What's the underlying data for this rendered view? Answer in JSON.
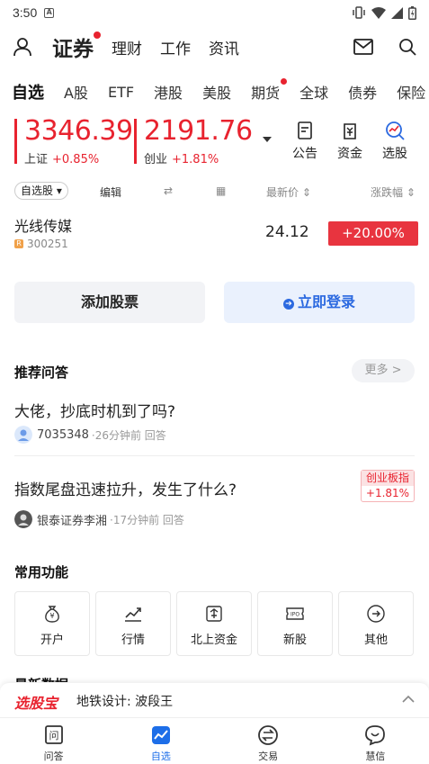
{
  "status_bar": {
    "time": "3:50",
    "notif_letter": "A"
  },
  "top_nav": {
    "items": [
      "证券",
      "理财",
      "工作",
      "资讯"
    ]
  },
  "tabs": [
    "自选",
    "A股",
    "ETF",
    "港股",
    "美股",
    "期货",
    "全球",
    "债券",
    "保险"
  ],
  "indices": [
    {
      "value": "3346.39",
      "name": "上证",
      "change": "+0.85%"
    },
    {
      "value": "2191.76",
      "name": "创业",
      "change": "+1.81%"
    }
  ],
  "quick_actions": [
    "公告",
    "资金",
    "选股"
  ],
  "list_header": {
    "group": "自选股",
    "edit": "编辑",
    "latest": "最新价 ⇕",
    "change": "涨跌幅 ⇕"
  },
  "stocks": [
    {
      "name": "光线传媒",
      "code": "300251",
      "badge": "R",
      "price": "24.12",
      "change": "+20.00%"
    }
  ],
  "buttons": {
    "add": "添加股票",
    "login": "立即登录",
    "login_icon": "➔"
  },
  "qa": {
    "title": "推荐问答",
    "more": "更多 >",
    "items": [
      {
        "question": "大佬，抄底时机到了吗?",
        "user": "7035348",
        "time": "·26分钟前 回答"
      },
      {
        "question": "指数尾盘迅速拉升，发生了什么?",
        "user": "银泰证券李湘",
        "time": "·17分钟前 回答",
        "tag": "创业板指",
        "tag_change": "+1.81%"
      }
    ]
  },
  "functions": {
    "title": "常用功能",
    "items": [
      "开户",
      "行情",
      "北上资金",
      "新股",
      "其他"
    ]
  },
  "latest_data_title": "最新数据",
  "ad": {
    "logo": "选股宝",
    "text": "地铁设计: 波段王"
  },
  "bottom_nav": [
    "问答",
    "自选",
    "交易",
    "慧信"
  ],
  "colors": {
    "up": "#e8232f",
    "accent": "#2b69e0",
    "active_nav": "#1d6ee8"
  }
}
